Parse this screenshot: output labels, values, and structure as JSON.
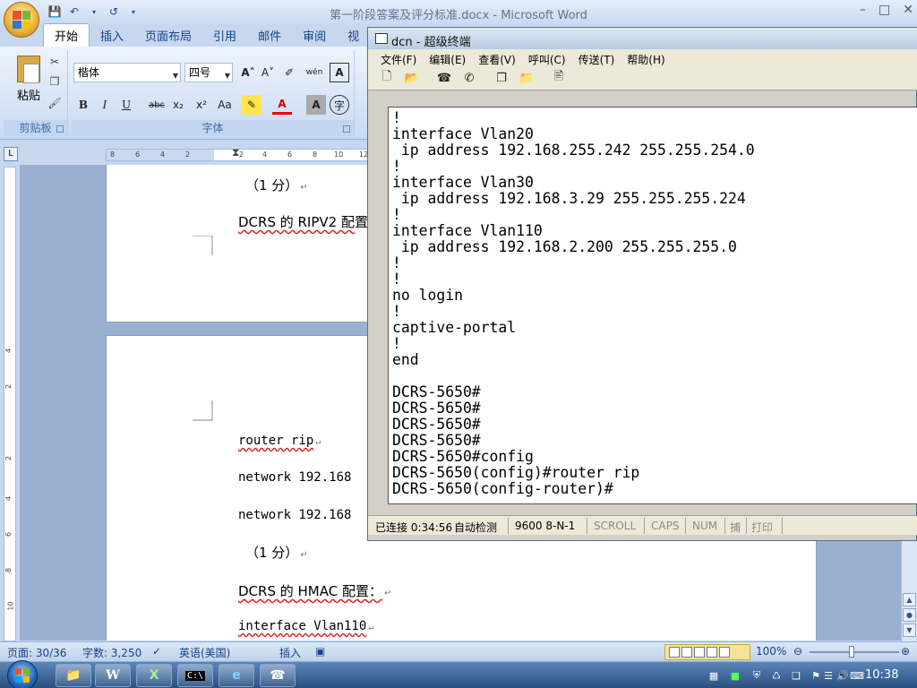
{
  "word": {
    "title": "第一阶段答案及评分标准.docx - Microsoft Word",
    "tabs": [
      "开始",
      "插入",
      "页面布局",
      "引用",
      "邮件",
      "审阅",
      "视"
    ],
    "ribbon": {
      "paste_label": "粘贴",
      "clipboard_group": "剪贴板",
      "font_group": "字体",
      "font_name": "楷体",
      "font_size": "四号"
    },
    "ruler_ticks": [
      "8",
      "6",
      "4",
      "2",
      "2",
      "4",
      "6",
      "8",
      "10",
      "12"
    ],
    "page1": {
      "line1": "（1 分）",
      "line2_pre": "DCRS 的 RIPV2 配",
      "line2_cut": "置"
    },
    "page2": {
      "line1": "router rip",
      "line2": "network 192.168",
      "line3": "network 192.168",
      "line4": "（1 分）",
      "line5": "DCRS 的 HMAC 配置：",
      "line6": "interface Vlan110"
    },
    "status": {
      "page": "页面: 30/36",
      "words": "字数: 3,250",
      "language": "英语(美国)",
      "insert": "插入",
      "zoom": "100%"
    }
  },
  "terminal": {
    "title": "dcn - 超级终端",
    "menu": [
      "文件(F)",
      "编辑(E)",
      "查看(V)",
      "呼叫(C)",
      "传送(T)",
      "帮助(H)"
    ],
    "lines": [
      "!",
      "interface Vlan20",
      " ip address 192.168.255.242 255.255.254.0",
      "!",
      "interface Vlan30",
      " ip address 192.168.3.29 255.255.255.224",
      "!",
      "interface Vlan110",
      " ip address 192.168.2.200 255.255.255.0",
      "!",
      "!",
      "no login",
      "!",
      "captive-portal",
      "!",
      "end",
      "",
      "DCRS-5650#",
      "DCRS-5650#",
      "DCRS-5650#",
      "DCRS-5650#",
      "DCRS-5650#config",
      "DCRS-5650(config)#router rip",
      "DCRS-5650(config-router)#"
    ],
    "status": {
      "connected": "已连接 0:34:56",
      "detect": "自动检测",
      "baud": "9600 8-N-1",
      "scroll": "SCROLL",
      "caps": "CAPS",
      "num": "NUM",
      "capture": "捕",
      "print": "打印"
    }
  },
  "taskbar": {
    "clock": "10:38"
  }
}
